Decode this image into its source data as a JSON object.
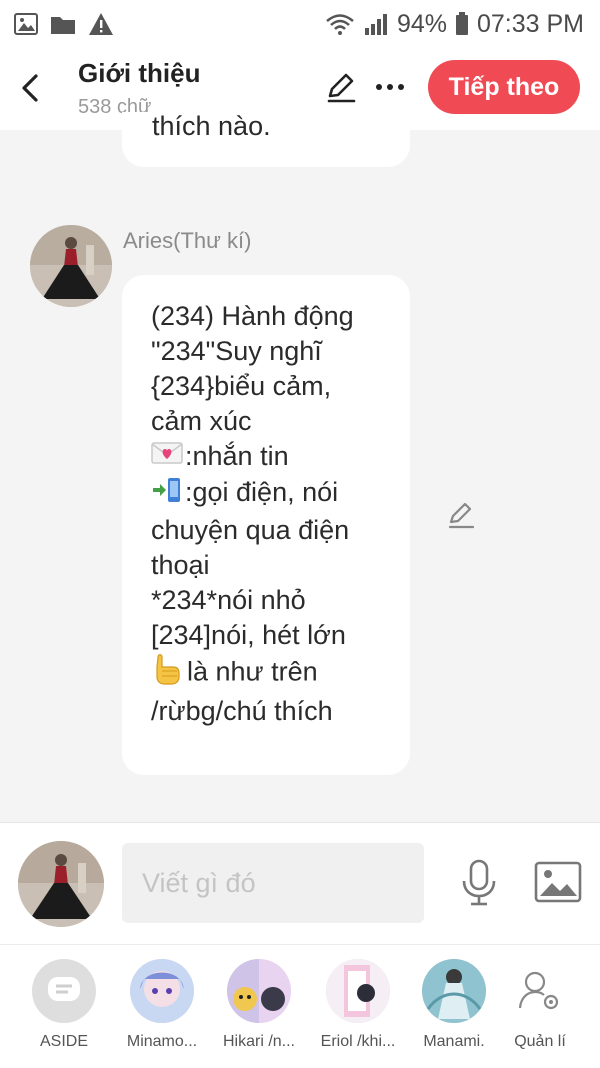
{
  "status_bar": {
    "battery": "94%",
    "time": "07:33 PM",
    "icons_left": [
      "image-icon",
      "folder-icon",
      "warning-icon"
    ],
    "icons_right": [
      "wifi-icon",
      "signal-icon",
      "battery-icon"
    ]
  },
  "header": {
    "title": "Giới thiệu",
    "subtitle": "538 chữ",
    "next_label": "Tiếp theo"
  },
  "prev_message": {
    "tail_text": "thích nào."
  },
  "message": {
    "sender": "Aries(Thư kí)",
    "lines": [
      "(234) Hành động",
      "\"234\"Suy nghĩ",
      "{234}biểu cảm,",
      "cảm xúc",
      ":nhắn tin",
      ":gọi điện, nói",
      "chuyện qua điện",
      "thoại",
      "*234*nói nhỏ",
      "[234]nói, hét lớn",
      "là như trên",
      "/rừbg/chú thích"
    ]
  },
  "composer": {
    "placeholder": "Viết gì đó"
  },
  "bottom_bar": {
    "items": [
      {
        "label": "ASIDE"
      },
      {
        "label": "Minamo..."
      },
      {
        "label": "Hikari /n..."
      },
      {
        "label": "Eriol /khi..."
      },
      {
        "label": "Manami."
      },
      {
        "label": "Quản lí"
      }
    ]
  },
  "colors": {
    "accent": "#f04a55",
    "background": "#f4f4f5"
  }
}
